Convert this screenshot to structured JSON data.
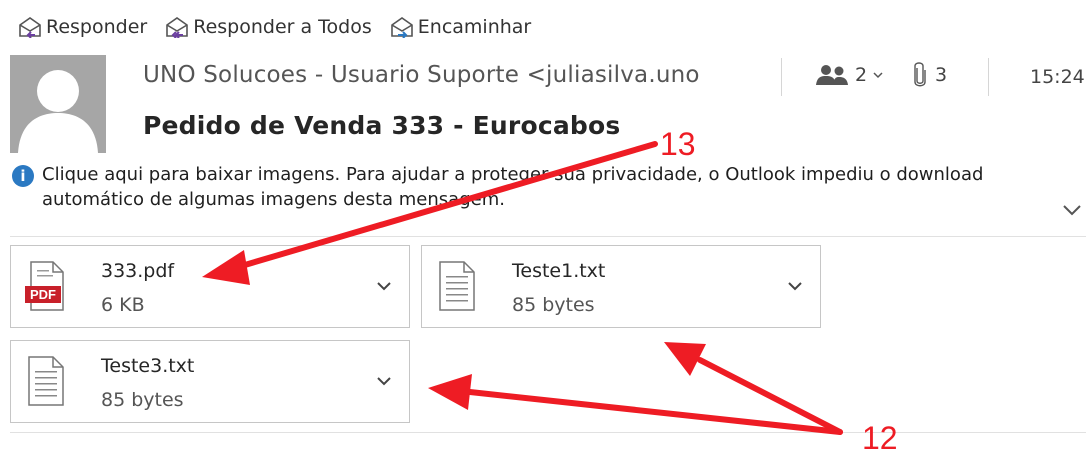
{
  "toolbar": {
    "reply_label": "Responder",
    "reply_all_label": "Responder a Todos",
    "forward_label": "Encaminhar"
  },
  "message": {
    "sender": "UNO Solucoes - Usuario Suporte <juliasilva.uno",
    "recipients_count": "2",
    "attachments_count": "3",
    "time": "15:24",
    "subject": "Pedido de Venda 333 - Eurocabos"
  },
  "infobar": {
    "text": "Clique aqui para baixar imagens. Para ajudar a proteger sua privacidade, o Outlook impediu o download automático de algumas imagens desta mensagem."
  },
  "attachments": [
    {
      "name": "333.pdf",
      "size": "6 KB",
      "type": "pdf",
      "type_label": "PDF"
    },
    {
      "name": "Teste1.txt",
      "size": "85 bytes",
      "type": "txt"
    },
    {
      "name": "Teste3.txt",
      "size": "85 bytes",
      "type": "txt"
    }
  ],
  "annotations": [
    {
      "label": "13"
    },
    {
      "label": "12"
    }
  ],
  "colors": {
    "annotation": "#ee1c24",
    "info_icon": "#2b79c2",
    "pdf_badge": "#c8202a",
    "avatar_bg": "#a6a6a6"
  }
}
